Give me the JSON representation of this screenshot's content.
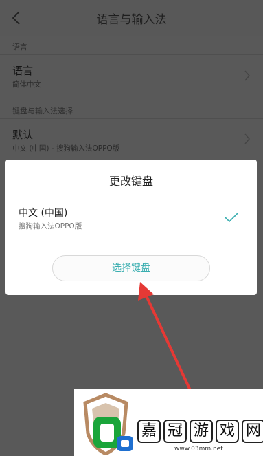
{
  "header": {
    "title": "语言与输入法"
  },
  "sections": {
    "language": {
      "header": "语言",
      "item_label": "语言",
      "item_value": "简体中文"
    },
    "keyboard": {
      "header": "键盘与输入法选择",
      "item_label": "默认",
      "item_value": "中文 (中国) - 搜狗输入法OPPO版"
    }
  },
  "dialog": {
    "title": "更改键盘",
    "option_label": "中文 (中国)",
    "option_sub": "搜狗输入法OPPO版",
    "option_selected": true,
    "button_label": "选择键盘",
    "accent_color": "#3aaeb0"
  },
  "watermark": {
    "chars": [
      "嘉",
      "冠",
      "游",
      "戏",
      "网"
    ],
    "url": "www.03mm.net"
  }
}
